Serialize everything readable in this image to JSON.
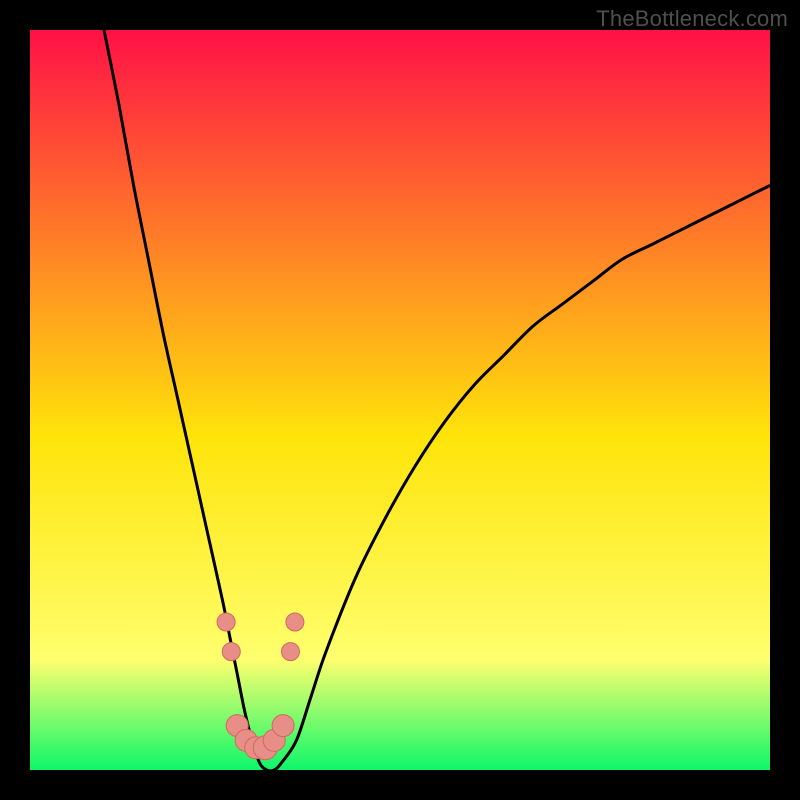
{
  "watermark": "TheBottleneck.com",
  "colors": {
    "frame": "#000000",
    "grad_top": "#ff1146",
    "grad_mid": "#ffe40a",
    "grad_low": "#ffff6e",
    "grad_bottom": "#0df76a",
    "curve": "#000000",
    "dot_fill": "#e78f86",
    "dot_stroke": "#d26860"
  },
  "chart_data": {
    "type": "line",
    "title": "",
    "xlabel": "",
    "ylabel": "",
    "xlim": [
      0,
      100
    ],
    "ylim": [
      0,
      100
    ],
    "series": [
      {
        "name": "bottleneck-curve",
        "x": [
          10,
          12,
          14,
          16,
          18,
          20,
          22,
          24,
          26,
          27,
          28,
          29,
          30,
          31,
          32,
          33,
          34,
          36,
          38,
          40,
          44,
          48,
          52,
          56,
          60,
          64,
          68,
          72,
          76,
          80,
          84,
          88,
          92,
          96,
          100
        ],
        "values": [
          100,
          90,
          79,
          69,
          59,
          50,
          41,
          32,
          23,
          18,
          13,
          8,
          4,
          1,
          0,
          0,
          1,
          4,
          10,
          16,
          26,
          34,
          41,
          47,
          52,
          56,
          60,
          63,
          66,
          69,
          71,
          73,
          75,
          77,
          79
        ]
      }
    ],
    "markers": [
      {
        "name": "sample-dot",
        "x": 26.5,
        "y": 20,
        "r": 9
      },
      {
        "name": "sample-dot",
        "x": 27.2,
        "y": 16,
        "r": 9
      },
      {
        "name": "sample-dot",
        "x": 28.0,
        "y": 6,
        "r": 11
      },
      {
        "name": "sample-dot",
        "x": 29.2,
        "y": 4,
        "r": 11
      },
      {
        "name": "sample-dot",
        "x": 30.5,
        "y": 3,
        "r": 11
      },
      {
        "name": "sample-dot",
        "x": 31.8,
        "y": 3,
        "r": 12
      },
      {
        "name": "sample-dot",
        "x": 33.0,
        "y": 4,
        "r": 11
      },
      {
        "name": "sample-dot",
        "x": 34.2,
        "y": 6,
        "r": 11
      },
      {
        "name": "sample-dot",
        "x": 35.2,
        "y": 16,
        "r": 9
      },
      {
        "name": "sample-dot",
        "x": 35.8,
        "y": 20,
        "r": 9
      }
    ]
  }
}
